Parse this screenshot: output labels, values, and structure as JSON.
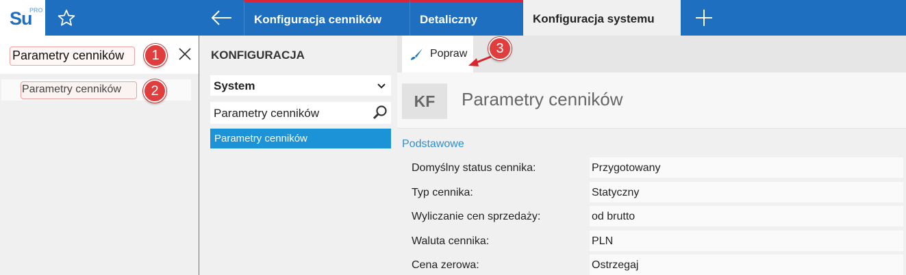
{
  "app": {
    "logo_text": "Su",
    "logo_sup": "PRO"
  },
  "tabs": [
    {
      "label": "Konfiguracja cenników"
    },
    {
      "label": "Detaliczny"
    },
    {
      "label": "Konfiguracja systemu"
    }
  ],
  "left": {
    "search_value": "Parametry cenników",
    "result_label": "Parametry cenników"
  },
  "callouts": [
    "1",
    "2",
    "3"
  ],
  "middle": {
    "title": "KONFIGURACJA",
    "select_value": "System",
    "filter_value": "Parametry cenników",
    "selected_item": "Parametry cenników"
  },
  "right": {
    "toolbar_button": "Popraw",
    "badge": "KF",
    "heading": "Parametry cenników",
    "section": "Podstawowe",
    "rows": [
      {
        "label": "Domyślny status cennika:",
        "value": "Przygotowany"
      },
      {
        "label": "Typ cennika:",
        "value": "Statyczny"
      },
      {
        "label": "Wyliczanie cen sprzedaży:",
        "value": "od brutto"
      },
      {
        "label": "Waluta cennika:",
        "value": "PLN"
      },
      {
        "label": "Cena zerowa:",
        "value": "Ostrzegaj"
      }
    ]
  },
  "colors": {
    "topbar": "#1e6fbf",
    "accent_tab_border": "#d9243a",
    "selected_item": "#1c93d6",
    "section_title": "#2b8fcf",
    "callout": "#e03e3e"
  },
  "icons": {
    "favorite": "star-icon",
    "back": "arrow-left-icon",
    "new_tab": "plus-icon",
    "clear": "close-icon",
    "dropdown": "chevron-down-icon",
    "filter": "search-icon",
    "edit": "brush-icon"
  }
}
